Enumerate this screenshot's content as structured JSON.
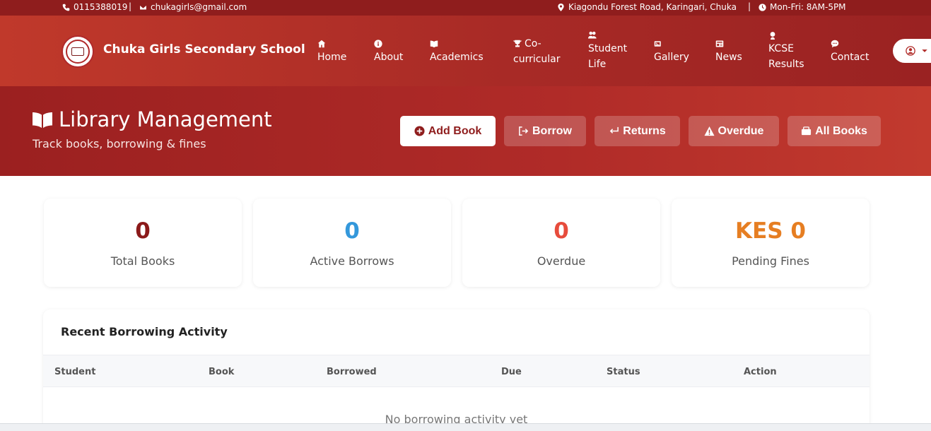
{
  "topbar": {
    "phone": "0115388019",
    "separator": "|",
    "email": "chukagirls@gmail.com",
    "address": "Kiagondu Forest Road, Karingari, Chuka",
    "hours": "Mon-Fri: 8AM-5PM",
    "icons": [
      "phone-icon",
      "mail-icon",
      "map-pin-icon",
      "clock-icon"
    ]
  },
  "navbar": {
    "brand": "Chuka Girls Secondary School",
    "items": [
      {
        "icon": "home-icon",
        "label": "Home"
      },
      {
        "icon": "info-icon",
        "label": "About"
      },
      {
        "icon": "book-icon",
        "label": "Academics"
      },
      {
        "icon": "trophy-icon",
        "label_line1": "Co-",
        "label_line2": "curricular"
      },
      {
        "icon": "users-icon",
        "label_line1": "Student",
        "label_line2": "Life"
      },
      {
        "icon": "images-icon",
        "label": "Gallery"
      },
      {
        "icon": "newspaper-icon",
        "label": "News"
      },
      {
        "icon": "graduate-icon",
        "label_line1": "KCSE",
        "label_line2": "Results"
      },
      {
        "icon": "chat-icon",
        "label": "Contact"
      }
    ],
    "user_icon": "user-circle-icon"
  },
  "hero": {
    "title": "Library Management",
    "subtitle": "Track books, borrowing & fines",
    "buttons": [
      {
        "icon": "plus-circle-icon",
        "label": "Add Book"
      },
      {
        "icon": "sign-out-icon",
        "label": "Borrow"
      },
      {
        "icon": "return-arrow-icon",
        "label": "Returns"
      },
      {
        "icon": "warning-icon",
        "label": "Overdue"
      },
      {
        "icon": "books-icon",
        "label": "All Books"
      }
    ]
  },
  "stats": [
    {
      "value": "0",
      "label": "Total Books",
      "color": "#8b1a1a"
    },
    {
      "value": "0",
      "label": "Active Borrows",
      "color": "#3498db"
    },
    {
      "value": "0",
      "label": "Overdue",
      "color": "#e74c3c"
    },
    {
      "value": "KES 0",
      "label": "Pending Fines",
      "color": "#e67e22"
    }
  ],
  "activity": {
    "title": "Recent Borrowing Activity",
    "columns": [
      "Student",
      "Book",
      "Borrowed",
      "Due",
      "Status",
      "Action"
    ],
    "empty_message": "No borrowing activity yet"
  },
  "colors": {
    "topbar": "#8f1d1d",
    "brand_red": "#b02b28",
    "accent": "#8f1d1d"
  }
}
